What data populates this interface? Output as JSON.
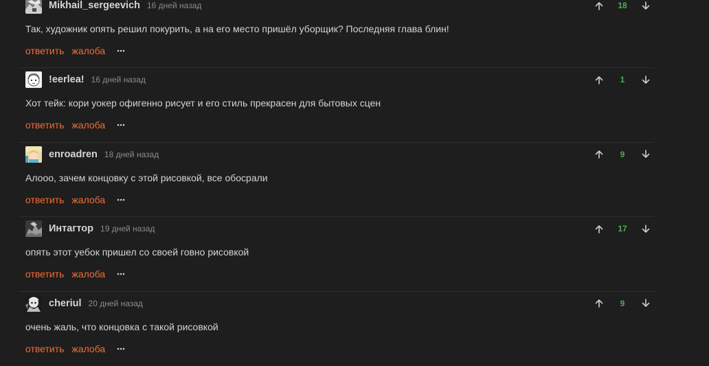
{
  "actions": {
    "reply_label": "ответить",
    "report_label": "жалоба",
    "more_icon": "more-dots-icon"
  },
  "colors": {
    "background": "#1e1e1e",
    "action_link": "#f26d33",
    "score": "#4caf50",
    "meta_text": "#8c8c8c"
  },
  "comments": [
    {
      "username": "Mikhail_sergeevich",
      "time": "16 дней назад",
      "text": "Так, художник опять решил покурить, а на его место пришёл уборщик? Последняя глава блин!",
      "score": "18"
    },
    {
      "username": "!eerlea!",
      "time": "16 дней назад",
      "text": "Хот тейк: кори уокер офигенно рисует и его стиль прекрасен для бытовых сцен",
      "score": "1"
    },
    {
      "username": "enroadren",
      "time": "18 дней назад",
      "text": "Алооо, зачем концовку с этой рисовкой, все обосрали",
      "score": "9"
    },
    {
      "username": "Интагтор",
      "time": "19 дней назад",
      "text": "опять этот уебок пришел со своей говно рисовкой",
      "score": "17"
    },
    {
      "username": "cheriul",
      "time": "20 дней назад",
      "text": "очень жаль, что концовка с такой рисовкой",
      "score": "9"
    }
  ]
}
